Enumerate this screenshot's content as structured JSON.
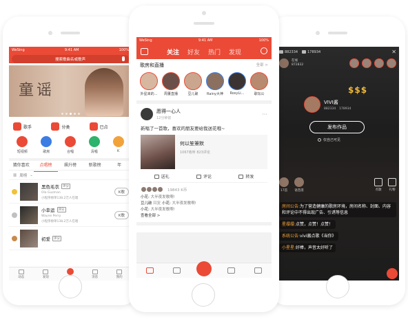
{
  "left": {
    "status": {
      "carrier": "WeSing",
      "time": "9:41 AM",
      "battery": "100%"
    },
    "search_placeholder": "搜索歌曲名或歌声",
    "banner_title": "童谣",
    "quick": [
      {
        "label": "歌手",
        "icon": "singer-icon"
      },
      {
        "label": "分类",
        "icon": "category-icon"
      },
      {
        "label": "已点",
        "icon": "ordered-icon"
      }
    ],
    "grid": [
      {
        "label": "短视频",
        "color": "#ea4a36"
      },
      {
        "label": "歌房",
        "color": "#3b7de3"
      },
      {
        "label": "合唱",
        "color": "#ea4a36"
      },
      {
        "label": "清唱",
        "color": "#2db36b"
      },
      {
        "label": "K",
        "color": "#f2a23a"
      }
    ],
    "tabs": [
      "猜你喜欢",
      "点唱榜",
      "飙升榜",
      "新歌榜",
      "年"
    ],
    "active_tab_index": 1,
    "filter_label": "周榜",
    "songs": [
      {
        "title": "黑色毛衣",
        "tag": "评分",
        "artist": "Ola Guzman",
        "sub": "小程序榜单138.2万人在唱",
        "k_label": "K歌",
        "medal_color": "#f2c13a"
      },
      {
        "title": "小幸运",
        "tag": "评分",
        "artist": "Wayne Perry",
        "sub": "小程序榜单138.2万人在唱",
        "k_label": "K歌",
        "medal_color": "#c0c0c0"
      },
      {
        "title": "初爱",
        "tag": "评分",
        "artist": "",
        "sub": "",
        "k_label": "",
        "medal_color": "#c98a4b"
      }
    ],
    "nav": [
      "动态",
      "发现",
      "点歌台",
      "消息",
      "我的"
    ],
    "nav_active_index": 2
  },
  "mid": {
    "status": {
      "carrier": "WeSing",
      "time": "9:41 AM",
      "battery": "100%"
    },
    "top_tabs": [
      "关注",
      "好友",
      "热门",
      "发现"
    ],
    "top_active_index": 0,
    "room_header": "歌房和直播",
    "room_all": "全部 >",
    "rooms": [
      {
        "label": "外星来的...",
        "ring": "red"
      },
      {
        "label": "周董直播",
        "ring": "red"
      },
      {
        "label": "豆儿破",
        "ring": "red"
      },
      {
        "label": "Rainy大神",
        "ring": "blue"
      },
      {
        "label": "RosyLi...",
        "ring": "blue"
      },
      {
        "label": "歌坛公",
        "ring": "red"
      }
    ],
    "post": {
      "user": "愿得一心人",
      "time": "12分钟前",
      "more": "···",
      "text": "新唱了一首歌，喜欢的朋友要给我送花哦~",
      "track_title": "何以笙箫默",
      "track_sub": "1067收听 823评论",
      "actions": [
        "送礼",
        "评论",
        "转发"
      ],
      "gift_count": "19843 K币",
      "comments": [
        {
          "user": "小花",
          "reply": "",
          "reply_to": "",
          "body": "大半夜发歌啊!"
        },
        {
          "user": "豆儿破",
          "reply": "回复",
          "reply_to": "小花",
          "body": "大半夜发歌啊!"
        },
        {
          "user": "小花",
          "reply": "",
          "reply_to": "",
          "body": "大半夜发歌啊!"
        }
      ],
      "view_all": "查看全部 >"
    }
  },
  "right": {
    "top_left_count": "882334",
    "top_right_count": "178934",
    "host_badge": "在线",
    "host_count": "872832",
    "money": "$$$",
    "host_name": "VIVI酱",
    "host_stat_1": "882334",
    "host_stat_2": "178934",
    "publish_button": "发布作品",
    "visibility": "仅自己可见",
    "mid_left": [
      {
        "label": "17首"
      },
      {
        "label": "语音席"
      }
    ],
    "mid_right": [
      "点歌",
      "礼物"
    ],
    "chat": [
      {
        "who": "房间公告:",
        "body": "为了营造健康的歌房环境，房间名称、封面、内容和评论中不得出现广告、引诱等信息"
      },
      {
        "who": "星缨缨:",
        "body": "点赞，点赞！点赞！"
      },
      {
        "who": "系统公告:",
        "body": "vivi酱点歌《当你》"
      },
      {
        "who": "小星星:",
        "body": "好棒，声音太好听了"
      }
    ]
  }
}
